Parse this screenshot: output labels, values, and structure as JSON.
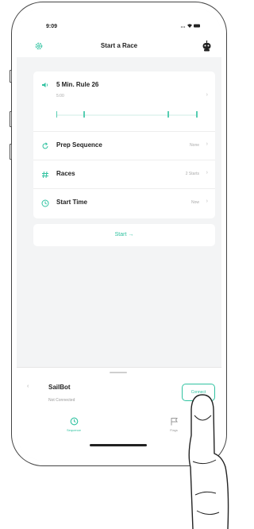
{
  "status_bar": {
    "time": "9:09",
    "icons": "... ▾ ▬"
  },
  "nav": {
    "title": "Start a Race",
    "left_icon": "gear-icon",
    "right_icon": "robot-icon"
  },
  "rule": {
    "title": "5 Min. Rule 26",
    "subtitle": "5:00",
    "icon": "speaker-icon",
    "timeline_marks": 4
  },
  "rows": [
    {
      "label": "Prep Sequence",
      "value": "None",
      "icon": "refresh-icon"
    },
    {
      "label": "Races",
      "value": "2 Starts",
      "icon": "hash-icon"
    },
    {
      "label": "Start Time",
      "value": "Now",
      "icon": "clock-icon"
    }
  ],
  "start_button": {
    "label": "Start →"
  },
  "device": {
    "name": "SailBot",
    "status": "Not Connected",
    "connect_label": "Connect"
  },
  "tabs": [
    {
      "label": "Sequence",
      "icon": "clock-icon",
      "active": true
    },
    {
      "label": "Flags",
      "icon": "flag-icon",
      "active": false
    }
  ],
  "colors": {
    "accent": "#2fc2a0",
    "background": "#f3f4f5",
    "card": "#ffffff"
  }
}
